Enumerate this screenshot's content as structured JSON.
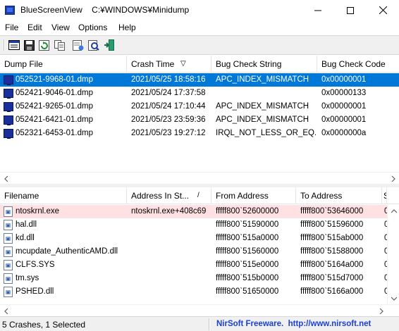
{
  "window": {
    "title": "BlueScreenView    C:¥WINDOWS¥Minidump",
    "controls": {
      "minimize": "minimize",
      "maximize": "maximize",
      "close": "close"
    }
  },
  "menu": [
    "File",
    "Edit",
    "View",
    "Options",
    "Help"
  ],
  "toolbar": {
    "buttons": [
      "properties-icon",
      "save-icon",
      "refresh-icon",
      "copy-icon",
      "html-report-icon",
      "advanced-options-icon",
      "exit-icon"
    ]
  },
  "top_table": {
    "columns": [
      "Dump File",
      "Crash Time",
      "Bug Check String",
      "Bug Check Code"
    ],
    "sort_indicator": "▽",
    "rows": [
      {
        "dump_file": "052521-9968-01.dmp",
        "crash_time": "2021/05/25 18:58:16",
        "bug_check_string": "APC_INDEX_MISMATCH",
        "bug_check_code": "0x00000001",
        "selected": true
      },
      {
        "dump_file": "052421-9046-01.dmp",
        "crash_time": "2021/05/24 17:37:58",
        "bug_check_string": "",
        "bug_check_code": "0x00000133",
        "selected": false
      },
      {
        "dump_file": "052421-9265-01.dmp",
        "crash_time": "2021/05/24 17:10:44",
        "bug_check_string": "APC_INDEX_MISMATCH",
        "bug_check_code": "0x00000001",
        "selected": false
      },
      {
        "dump_file": "052421-6421-01.dmp",
        "crash_time": "2021/05/23 23:59:36",
        "bug_check_string": "APC_INDEX_MISMATCH",
        "bug_check_code": "0x00000001",
        "selected": false
      },
      {
        "dump_file": "052321-6453-01.dmp",
        "crash_time": "2021/05/23 19:27:12",
        "bug_check_string": "IRQL_NOT_LESS_OR_EQ...",
        "bug_check_code": "0x0000000a",
        "selected": false
      }
    ]
  },
  "bottom_table": {
    "columns": [
      "Filename",
      "Address In St...",
      "From Address",
      "To Address",
      "S"
    ],
    "sort_indicator": "/",
    "rows": [
      {
        "filename": "ntoskrnl.exe",
        "address_in_stack": "ntoskrnl.exe+408c69",
        "from_address": "fffff800`52600000",
        "to_address": "fffff800`53646000",
        "extra": "0",
        "highlighted": true
      },
      {
        "filename": "hal.dll",
        "address_in_stack": "",
        "from_address": "fffff800`51590000",
        "to_address": "fffff800`51596000",
        "extra": "0",
        "highlighted": false
      },
      {
        "filename": "kd.dll",
        "address_in_stack": "",
        "from_address": "fffff800`515a0000",
        "to_address": "fffff800`515ab000",
        "extra": "0",
        "highlighted": false
      },
      {
        "filename": "mcupdate_AuthenticAMD.dll",
        "address_in_stack": "",
        "from_address": "fffff800`51560000",
        "to_address": "fffff800`51588000",
        "extra": "0",
        "highlighted": false
      },
      {
        "filename": "CLFS.SYS",
        "address_in_stack": "",
        "from_address": "fffff800`515e0000",
        "to_address": "fffff800`5164a000",
        "extra": "0",
        "highlighted": false
      },
      {
        "filename": "tm.sys",
        "address_in_stack": "",
        "from_address": "fffff800`515b0000",
        "to_address": "fffff800`515d7000",
        "extra": "0",
        "highlighted": false
      },
      {
        "filename": "PSHED.dll",
        "address_in_stack": "",
        "from_address": "fffff800`51650000",
        "to_address": "fffff800`5166a000",
        "extra": "0",
        "highlighted": false
      }
    ]
  },
  "status": {
    "summary": "5 Crashes, 1 Selected",
    "link": "NirSoft Freeware.  http://www.nirsoft.net"
  },
  "colors": {
    "selection": "#0078d7",
    "highlight_row": "#ffe0e3",
    "link": "#1a3fd6"
  }
}
